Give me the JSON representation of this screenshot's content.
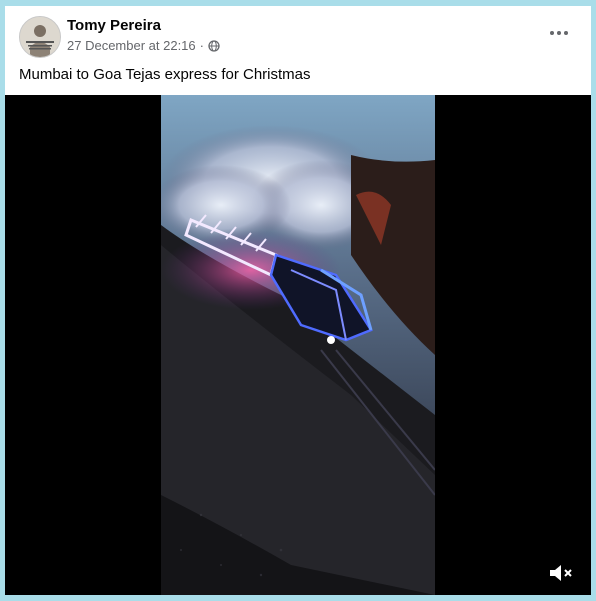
{
  "post": {
    "author": "Tomy Pereira",
    "timestamp": "27 December at 22:16",
    "separator": "·",
    "audience_icon": "globe-icon",
    "caption": "Mumbai to Goa Tejas express for Christmas",
    "more_icon": "more-options-icon"
  },
  "video": {
    "mute_icon": "speaker-muted-icon"
  }
}
